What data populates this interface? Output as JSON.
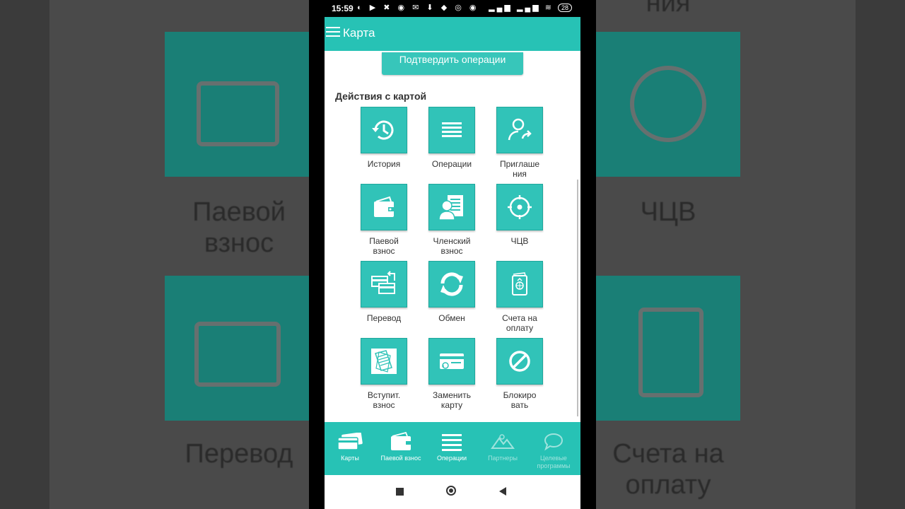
{
  "status_bar": {
    "time": "15:59",
    "battery": "28"
  },
  "app_bar": {
    "title": "Карта"
  },
  "confirm_button": "Подтвердить операции",
  "section_title": "Действия с картой",
  "actions": [
    {
      "label": "История",
      "icon": "history-icon"
    },
    {
      "label": "Операции",
      "icon": "list-icon"
    },
    {
      "label": "Приглаше\nния",
      "icon": "invite-user-icon"
    },
    {
      "label": "Паевой\nвзнос",
      "icon": "wallet-icon"
    },
    {
      "label": "Членский\nвзнос",
      "icon": "member-card-icon"
    },
    {
      "label": "ЧЦВ",
      "icon": "target-icon"
    },
    {
      "label": "Перевод",
      "icon": "transfer-cards-icon"
    },
    {
      "label": "Обмен",
      "icon": "exchange-icon"
    },
    {
      "label": "Счета на\nоплату",
      "icon": "invoice-icon"
    },
    {
      "label": "Вступит.\nвзнос",
      "icon": "documents-icon"
    },
    {
      "label": "Заменить\nкарту",
      "icon": "replace-card-icon"
    },
    {
      "label": "Блокиро\nвать",
      "icon": "block-icon"
    }
  ],
  "bottom_nav": [
    {
      "label": "Карты",
      "icon": "cards-icon"
    },
    {
      "label": "Паевой взнос",
      "icon": "wallet-icon"
    },
    {
      "label": "Операции",
      "icon": "list-icon"
    },
    {
      "label": "Партнеры",
      "icon": "mountains-icon"
    },
    {
      "label": "Целевые\nпрограммы",
      "icon": "chat-bubble-icon"
    }
  ],
  "background_labels": {
    "top_right": "ния",
    "left_1": "Паевой\nвзнос",
    "right_1": "ЧЦВ",
    "left_2": "Перевод",
    "right_2": "Счета на\nоплату"
  },
  "colors": {
    "accent": "#27c2b5",
    "tile": "#31c3b8"
  }
}
